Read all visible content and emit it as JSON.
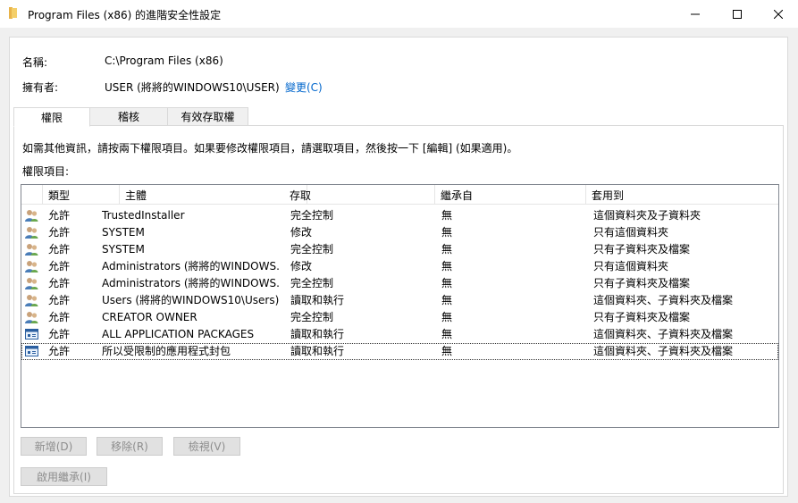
{
  "window": {
    "title": "Program Files (x86) 的進階安全性設定"
  },
  "info": {
    "name_label": "名稱:",
    "name_value": "C:\\Program Files (x86)",
    "owner_label": "擁有者:",
    "owner_value": "USER (將將的WINDOWS10\\USER)",
    "change_link": "變更(C)"
  },
  "tabs": [
    {
      "label": "權限"
    },
    {
      "label": "稽核"
    },
    {
      "label": "有效存取權"
    }
  ],
  "instruction": "如需其他資訊，請按兩下權限項目。如果要修改權限項目，請選取項目，然後按一下 [編輯] (如果適用)。",
  "entries_label": "權限項目:",
  "columns": [
    "類型",
    "主體",
    "存取",
    "繼承自",
    "套用到"
  ],
  "rows": [
    {
      "icon": "users-icon",
      "type": "允許",
      "principal": "TrustedInstaller",
      "access": "完全控制",
      "inherited": "無",
      "applies": "這個資料夾及子資料夾"
    },
    {
      "icon": "users-icon",
      "type": "允許",
      "principal": "SYSTEM",
      "access": "修改",
      "inherited": "無",
      "applies": "只有這個資料夾"
    },
    {
      "icon": "users-icon",
      "type": "允許",
      "principal": "SYSTEM",
      "access": "完全控制",
      "inherited": "無",
      "applies": "只有子資料夾及檔案"
    },
    {
      "icon": "users-icon",
      "type": "允許",
      "principal": "Administrators (將將的WINDOWS...",
      "access": "修改",
      "inherited": "無",
      "applies": "只有這個資料夾"
    },
    {
      "icon": "users-icon",
      "type": "允許",
      "principal": "Administrators (將將的WINDOWS...",
      "access": "完全控制",
      "inherited": "無",
      "applies": "只有子資料夾及檔案"
    },
    {
      "icon": "users-icon",
      "type": "允許",
      "principal": "Users (將將的WINDOWS10\\Users)",
      "access": "讀取和執行",
      "inherited": "無",
      "applies": "這個資料夾、子資料夾及檔案"
    },
    {
      "icon": "users-icon",
      "type": "允許",
      "principal": "CREATOR OWNER",
      "access": "完全控制",
      "inherited": "無",
      "applies": "只有子資料夾及檔案"
    },
    {
      "icon": "package-icon",
      "type": "允許",
      "principal": "ALL APPLICATION PACKAGES",
      "access": "讀取和執行",
      "inherited": "無",
      "applies": "這個資料夾、子資料夾及檔案"
    },
    {
      "icon": "package-icon",
      "type": "允許",
      "principal": "所以受限制的應用程式封包",
      "access": "讀取和執行",
      "inherited": "無",
      "applies": "這個資料夾、子資料夾及檔案"
    }
  ],
  "buttons": {
    "add": "新增(D)",
    "remove": "移除(R)",
    "view": "檢視(V)",
    "enable_inheritance": "啟用繼承(I)"
  },
  "colors": {
    "link": "#0066cc",
    "disabled_text": "#8d8d8d"
  }
}
